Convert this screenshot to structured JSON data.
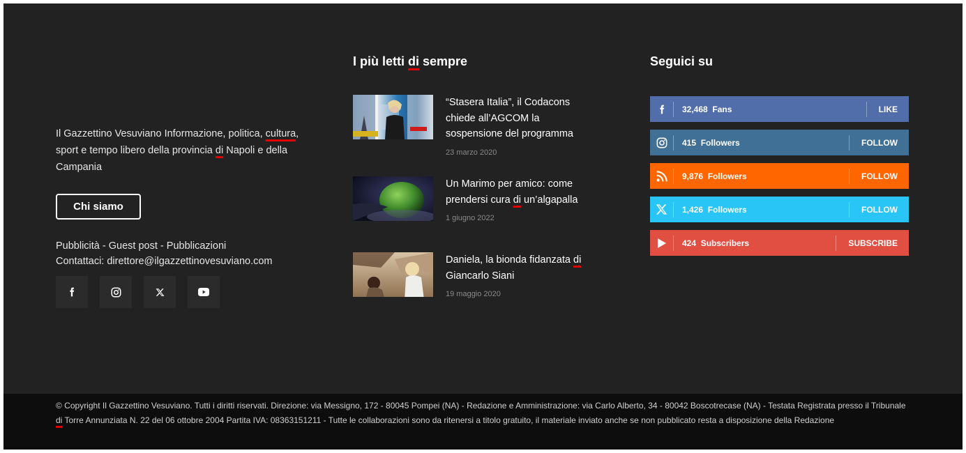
{
  "about": {
    "part1": "Il Gazzettino Vesuviano Informazione, politica, ",
    "cultura": "cultura",
    "part2": ", sport e tempo libero della provincia ",
    "di": "di",
    "part3": " Napoli e della Campania",
    "button_label": "Chi siamo",
    "link_pubblicita": "Pubblicità",
    "link_guest": "Guest post",
    "link_pubblicazioni": "Pubblicazioni",
    "separator": " - ",
    "contact": "Contattaci: direttore@ilgazzettinovesuviano.com"
  },
  "social_icons": [
    "facebook-icon",
    "instagram-icon",
    "x-icon",
    "youtube-icon"
  ],
  "popular": {
    "title_part1": "I più letti ",
    "title_di": "di",
    "title_part2": " sempre",
    "articles": [
      {
        "title": "“Stasera Italia”, il Codacons chiede all’AGCOM la sospensione del programma",
        "date": "23 marzo 2020"
      },
      {
        "title_part1": "Un Marimo per amico: come prendersi cura ",
        "title_di": "di",
        "title_part2": " un’algapalla",
        "date": "1 giugno 2022"
      },
      {
        "title_part1": "Daniela, la bionda fidanzata ",
        "title_di": "di",
        "title_part2": " Giancarlo Siani",
        "date": "19 maggio 2020"
      }
    ]
  },
  "follow": {
    "title": "Seguici su",
    "items": [
      {
        "network": "facebook",
        "count": "32,468",
        "unit": "Fans",
        "action": "LIKE",
        "color": "#516eab"
      },
      {
        "network": "instagram",
        "count": "415",
        "unit": "Followers",
        "action": "FOLLOW",
        "color": "#417096"
      },
      {
        "network": "rss",
        "count": "9,876",
        "unit": "Followers",
        "action": "FOLLOW",
        "color": "#ff6600"
      },
      {
        "network": "x",
        "count": "1,426",
        "unit": "Followers",
        "action": "FOLLOW",
        "color": "#29c5f6"
      },
      {
        "network": "youtube",
        "count": "424",
        "unit": "Subscribers",
        "action": "SUBSCRIBE",
        "color": "#e14e42"
      }
    ]
  },
  "copyright": {
    "part1": "© Copyright Il Gazzettino Vesuviano. Tutti i diritti riservati. Direzione: via Messigno, 172 - 80045 Pompei (NA) - Redazione e Amministrazione: via Carlo Alberto, 34 - 80042 Boscotrecase (NA) - Testata Registrata presso il Tribunale ",
    "di": "di",
    "part2": " Torre Annunziata N. 22 del 06 ottobre 2004 Partita IVA: 08363151211 - Tutte le collaborazioni sono da ritenersi a titolo gratuito, il materiale inviato anche se non pubblicato resta a disposizione della Redazione"
  }
}
